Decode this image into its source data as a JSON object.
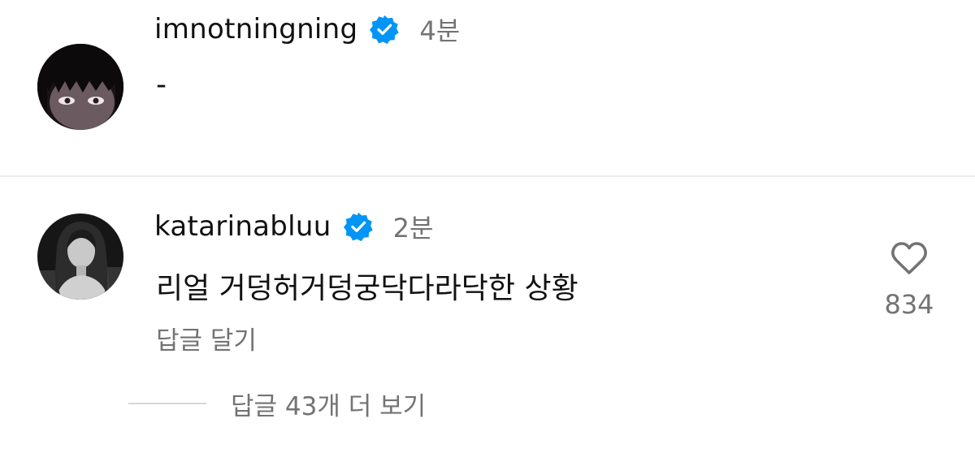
{
  "comments": [
    {
      "username": "imnotningning",
      "verified_icon": "verified-badge-icon",
      "timestamp": "4분",
      "text": "-"
    },
    {
      "username": "katarinabluu",
      "verified_icon": "verified-badge-icon",
      "timestamp": "2분",
      "text": "리얼 거덩허거덩궁닥다라닥한 상황",
      "reply_label": "답글 달기",
      "like_icon": "heart-outline-icon",
      "like_count": "834",
      "view_replies_label": "답글 43개 더 보기"
    }
  ],
  "colors": {
    "verified": "#0095f6",
    "secondary_text": "#737373",
    "primary_text": "#111111",
    "divider": "#ececec"
  }
}
